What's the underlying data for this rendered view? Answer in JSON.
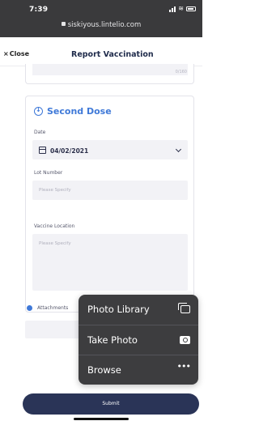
{
  "status_bar": {
    "time": "7:39",
    "url": "siskiyous.lintelio.com"
  },
  "header": {
    "close_label": "Close",
    "title": "Report Vaccination"
  },
  "top_card": {
    "counter": "0/160"
  },
  "second_dose": {
    "title": "Second Dose",
    "date_label": "Date",
    "date_value": "04/02/2021",
    "lot_label": "Lot Number",
    "lot_placeholder": "Please Specify",
    "location_label": "Vaccine Location",
    "location_placeholder": "Please Specify"
  },
  "attachments": {
    "label": "Attachments"
  },
  "submit_label": "Submit",
  "action_menu": {
    "items": [
      {
        "label": "Photo Library",
        "icon": "photo-library-icon"
      },
      {
        "label": "Take Photo",
        "icon": "camera-icon"
      },
      {
        "label": "Browse",
        "icon": "ellipsis-icon"
      }
    ]
  },
  "colors": {
    "accent": "#3f79d8",
    "submit_bg": "#2a3457",
    "menu_bg": "#3d3d3f"
  }
}
